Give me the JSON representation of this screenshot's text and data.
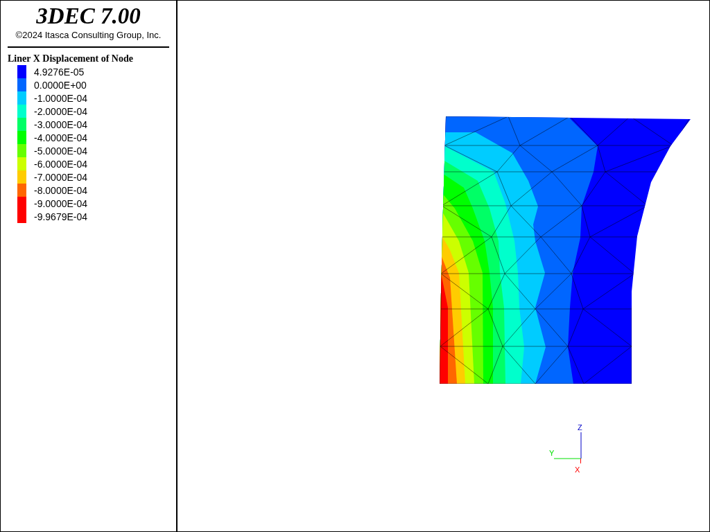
{
  "title": "3DEC 7.00",
  "copyright": "©2024 Itasca Consulting Group, Inc.",
  "legend": {
    "title": "Liner X Displacement of Node",
    "items": [
      {
        "label": "4.9276E-05",
        "color": "#0000ff"
      },
      {
        "label": "0.0000E+00",
        "color": "#0066ff"
      },
      {
        "label": "-1.0000E-04",
        "color": "#00ccff"
      },
      {
        "label": "-2.0000E-04",
        "color": "#00ffcc"
      },
      {
        "label": "-3.0000E-04",
        "color": "#00ff66"
      },
      {
        "label": "-4.0000E-04",
        "color": "#00ff00"
      },
      {
        "label": "-5.0000E-04",
        "color": "#66ff00"
      },
      {
        "label": "-6.0000E-04",
        "color": "#ccff00"
      },
      {
        "label": "-7.0000E-04",
        "color": "#ffcc00"
      },
      {
        "label": "-8.0000E-04",
        "color": "#ff6600"
      },
      {
        "label": "-9.0000E-04",
        "color": "#ff0000"
      },
      {
        "label": "-9.9679E-04",
        "color": "#ff0000"
      }
    ]
  },
  "axes": {
    "z": "Z",
    "y": "Y",
    "x": "X"
  }
}
